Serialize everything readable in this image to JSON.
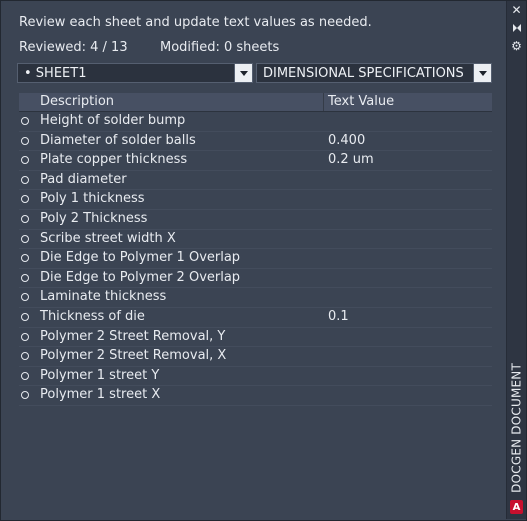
{
  "instructions": "Review each sheet and update text values as needed.",
  "status": {
    "reviewed": "Reviewed: 4 / 13",
    "modified": "Modified: 0 sheets"
  },
  "sheet_select": {
    "value": "• SHEET1"
  },
  "category_select": {
    "value": "DIMENSIONAL SPECIFICATIONS"
  },
  "table": {
    "columns": [
      "Description",
      "Text Value"
    ],
    "rows": [
      {
        "description": "Height of solder bump",
        "value": ""
      },
      {
        "description": "Diameter of solder balls",
        "value": "0.400"
      },
      {
        "description": "Plate copper thickness",
        "value": "0.2 um"
      },
      {
        "description": "Pad diameter",
        "value": ""
      },
      {
        "description": "Poly 1 thickness",
        "value": ""
      },
      {
        "description": "Poly 2 Thickness",
        "value": ""
      },
      {
        "description": "Scribe street width X",
        "value": ""
      },
      {
        "description": "Die Edge to Polymer 1 Overlap",
        "value": ""
      },
      {
        "description": "Die Edge to Polymer 2 Overlap",
        "value": ""
      },
      {
        "description": "Laminate thickness",
        "value": ""
      },
      {
        "description": "Thickness of die",
        "value": "0.1"
      },
      {
        "description": "Polymer 2 Street Removal, Y",
        "value": ""
      },
      {
        "description": "Polymer 2 Street Removal, X",
        "value": ""
      },
      {
        "description": "Polymer 1 street Y",
        "value": ""
      },
      {
        "description": "Polymer 1 street X",
        "value": ""
      }
    ]
  },
  "side_panel": {
    "title": "DOCGEN DOCUMENT",
    "brand_letter": "A",
    "icons": [
      "close-icon",
      "pin-icon",
      "gear-icon"
    ]
  }
}
